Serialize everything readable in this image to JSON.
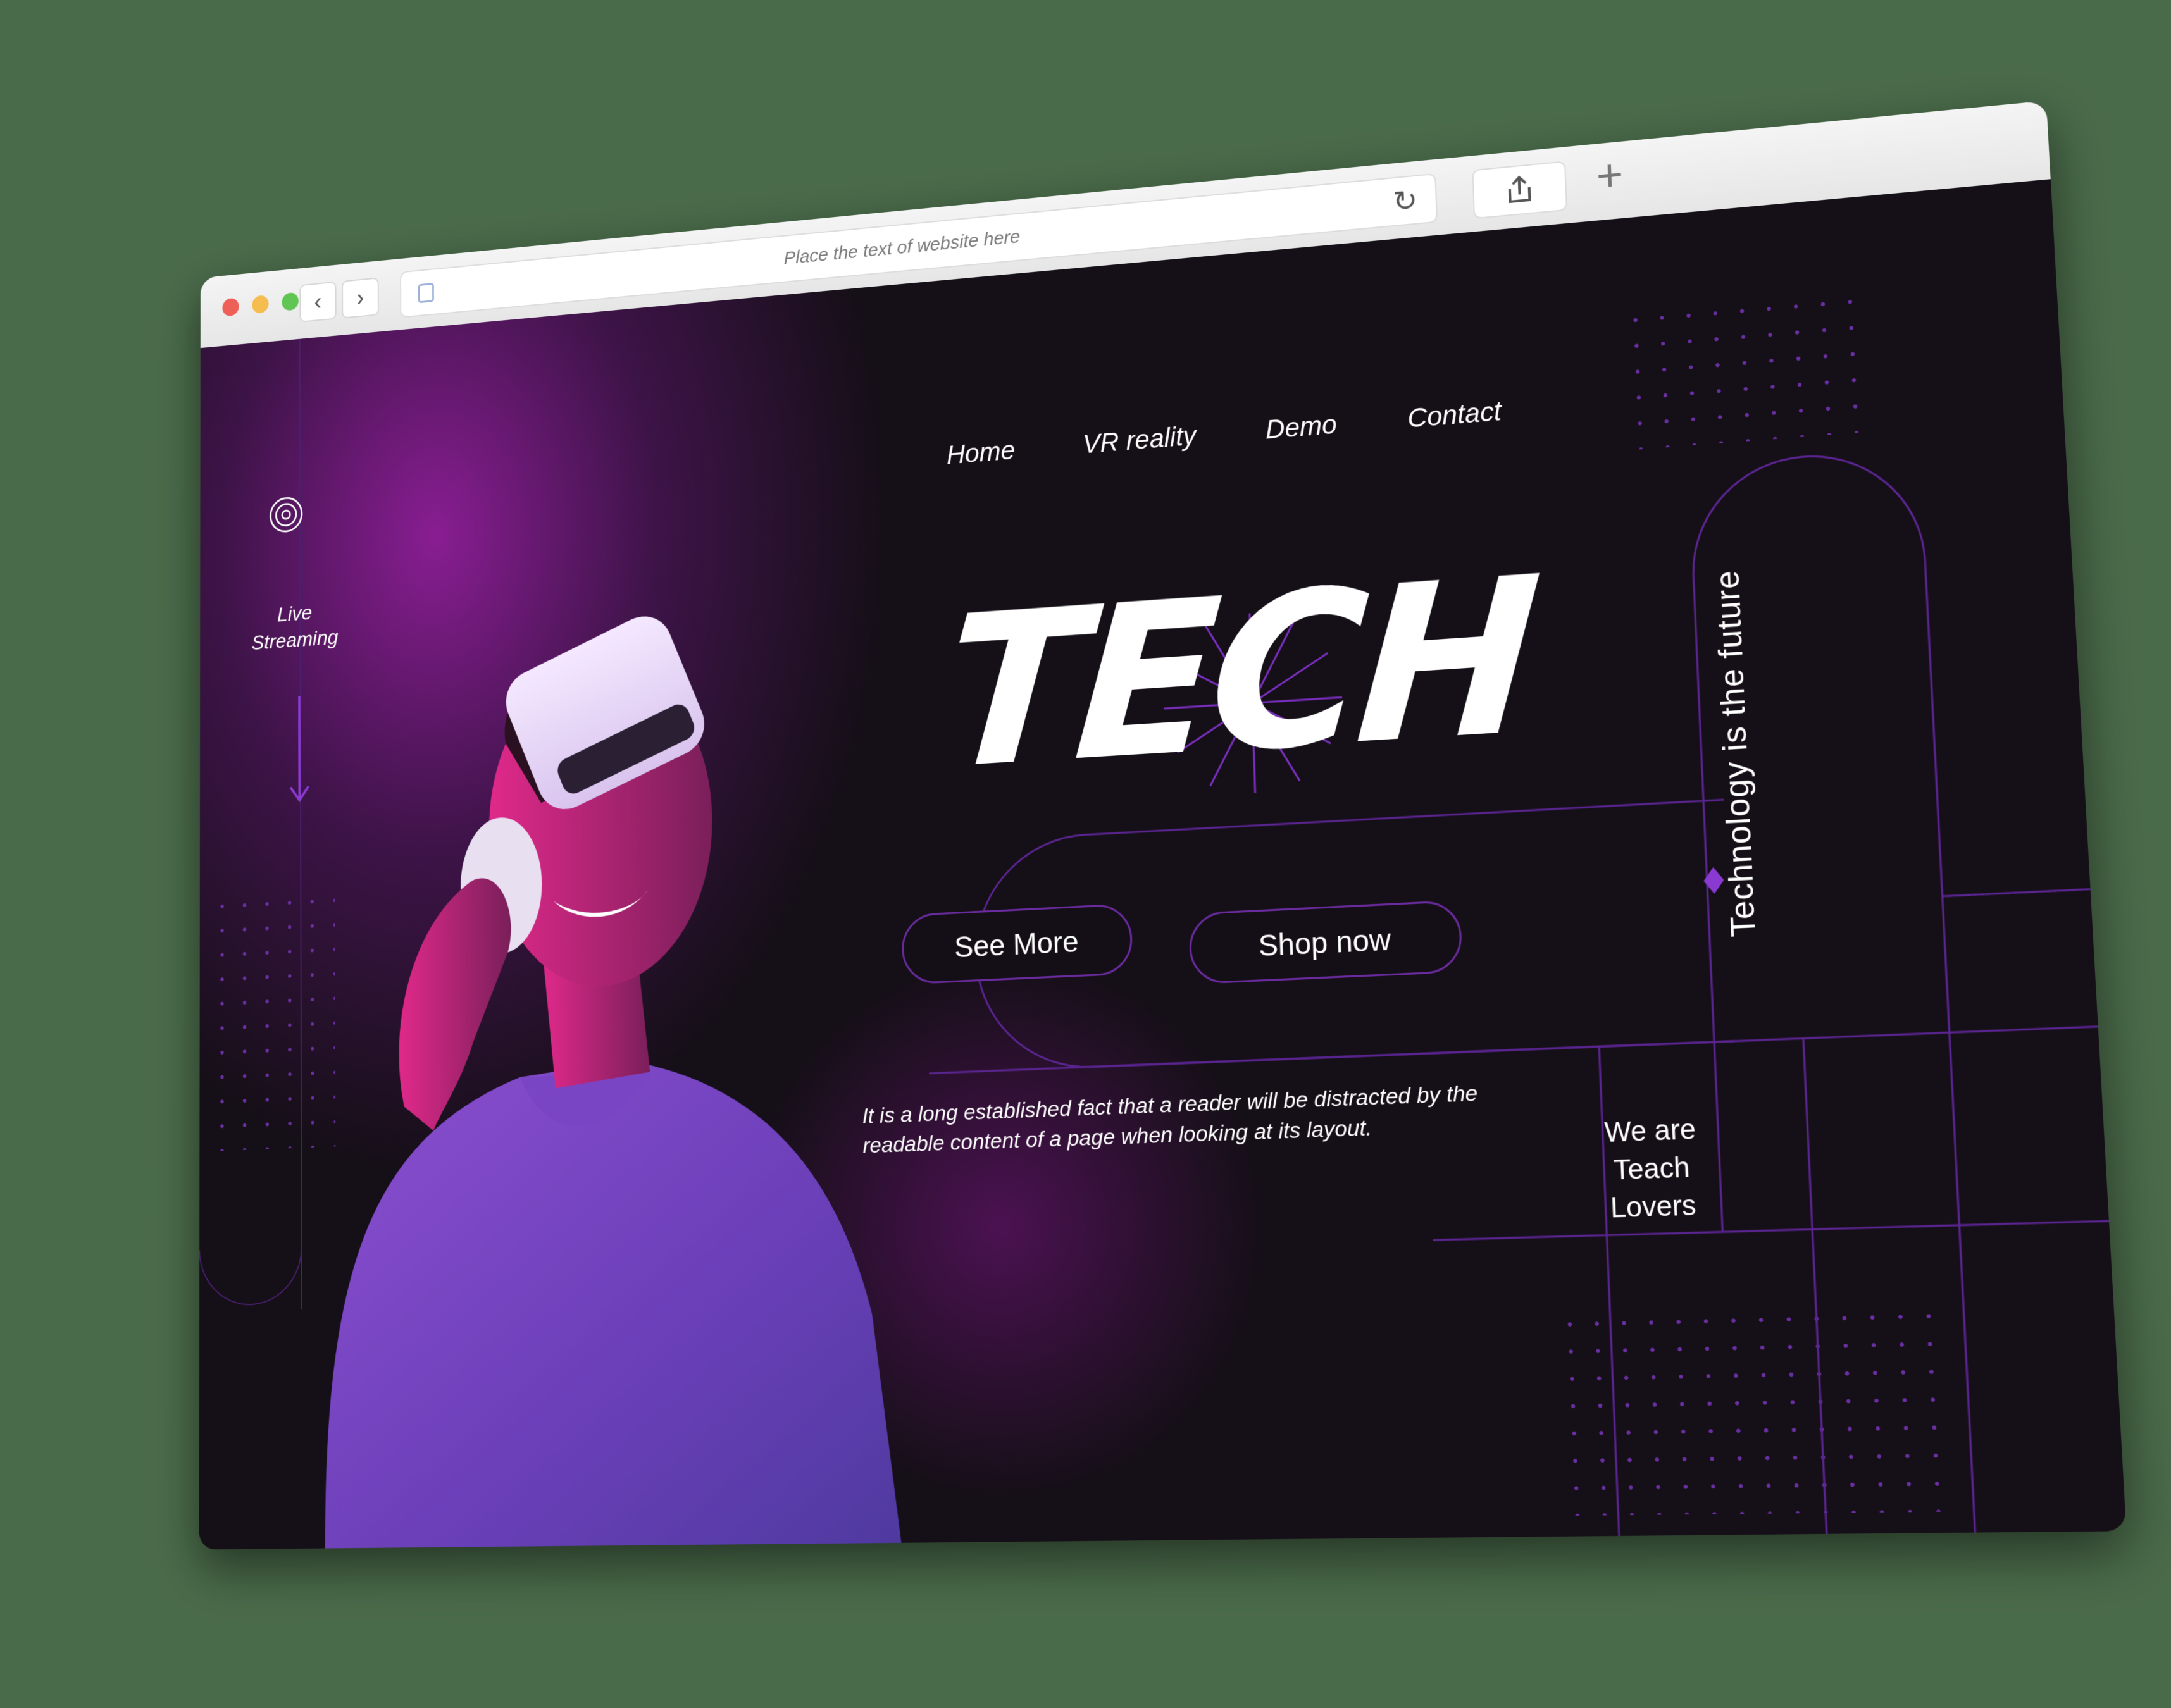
{
  "browser": {
    "url_placeholder": "Place the text of website here",
    "back_icon": "chevron-left-icon",
    "forward_icon": "chevron-right-icon",
    "reload_icon": "reload-icon",
    "share_icon": "share-icon",
    "new_tab_icon": "plus-icon",
    "back_glyph": "‹",
    "forward_glyph": "›",
    "reload_glyph": "↻",
    "plus_glyph": "+"
  },
  "sidebar": {
    "live_line1": "Live",
    "live_line2": "Streaming"
  },
  "nav": {
    "items": [
      {
        "label": "Home"
      },
      {
        "label": "VR reality"
      },
      {
        "label": "Demo"
      },
      {
        "label": "Contact"
      }
    ]
  },
  "hero": {
    "title": "TECH",
    "see_more": "See More",
    "shop_now": "Shop now",
    "description": "It is a long established fact that a reader will be distracted by the readable content of a page when looking at its layout.",
    "tagline_vertical": "Technology is the future",
    "we_are_line1": "We are",
    "we_are_line2": "Teach",
    "we_are_line3": "Lovers"
  },
  "colors": {
    "accent": "#6a2b9e",
    "background": "#150f17",
    "glow": "#9d20a8",
    "text": "#ffffff"
  }
}
